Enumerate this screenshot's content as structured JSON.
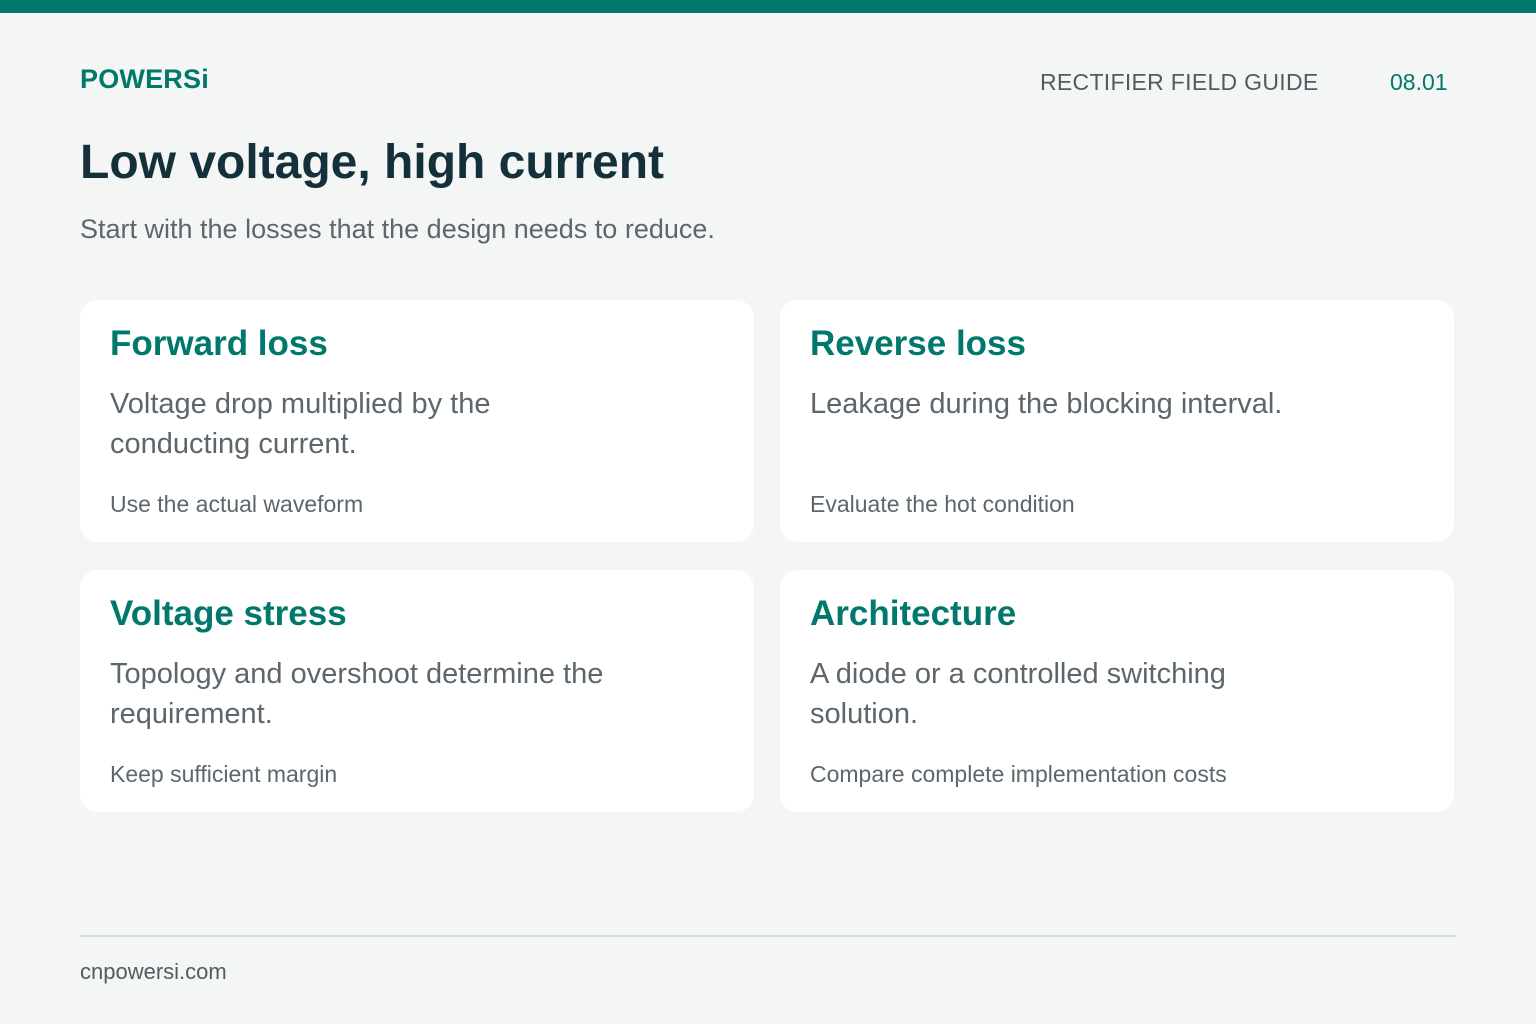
{
  "header": {
    "brand": "POWERSi",
    "guide_label": "RECTIFIER FIELD GUIDE",
    "page_number": "08.01"
  },
  "main": {
    "title": "Low voltage, high current",
    "subtitle": "Start with the losses that the design needs to reduce.",
    "cards": [
      {
        "title": "Forward loss",
        "description": "Voltage drop multiplied by the conducting current.",
        "note": "Use the actual waveform"
      },
      {
        "title": "Reverse loss",
        "description": "Leakage during the blocking interval.",
        "note": "Evaluate the hot condition"
      },
      {
        "title": "Voltage stress",
        "description": "Topology and overshoot determine the requirement.",
        "note": "Keep sufficient margin"
      },
      {
        "title": "Architecture",
        "description": "A diode or a controlled switching solution.",
        "note": "Compare complete implementation costs"
      }
    ]
  },
  "footer": {
    "website": "cnpowersi.com"
  },
  "colors": {
    "accent": "#00786b",
    "title": "#14303a",
    "body_text": "#5b676c",
    "background": "#f4f6f5",
    "card": "#ffffff",
    "divider": "#cfdfd9"
  }
}
